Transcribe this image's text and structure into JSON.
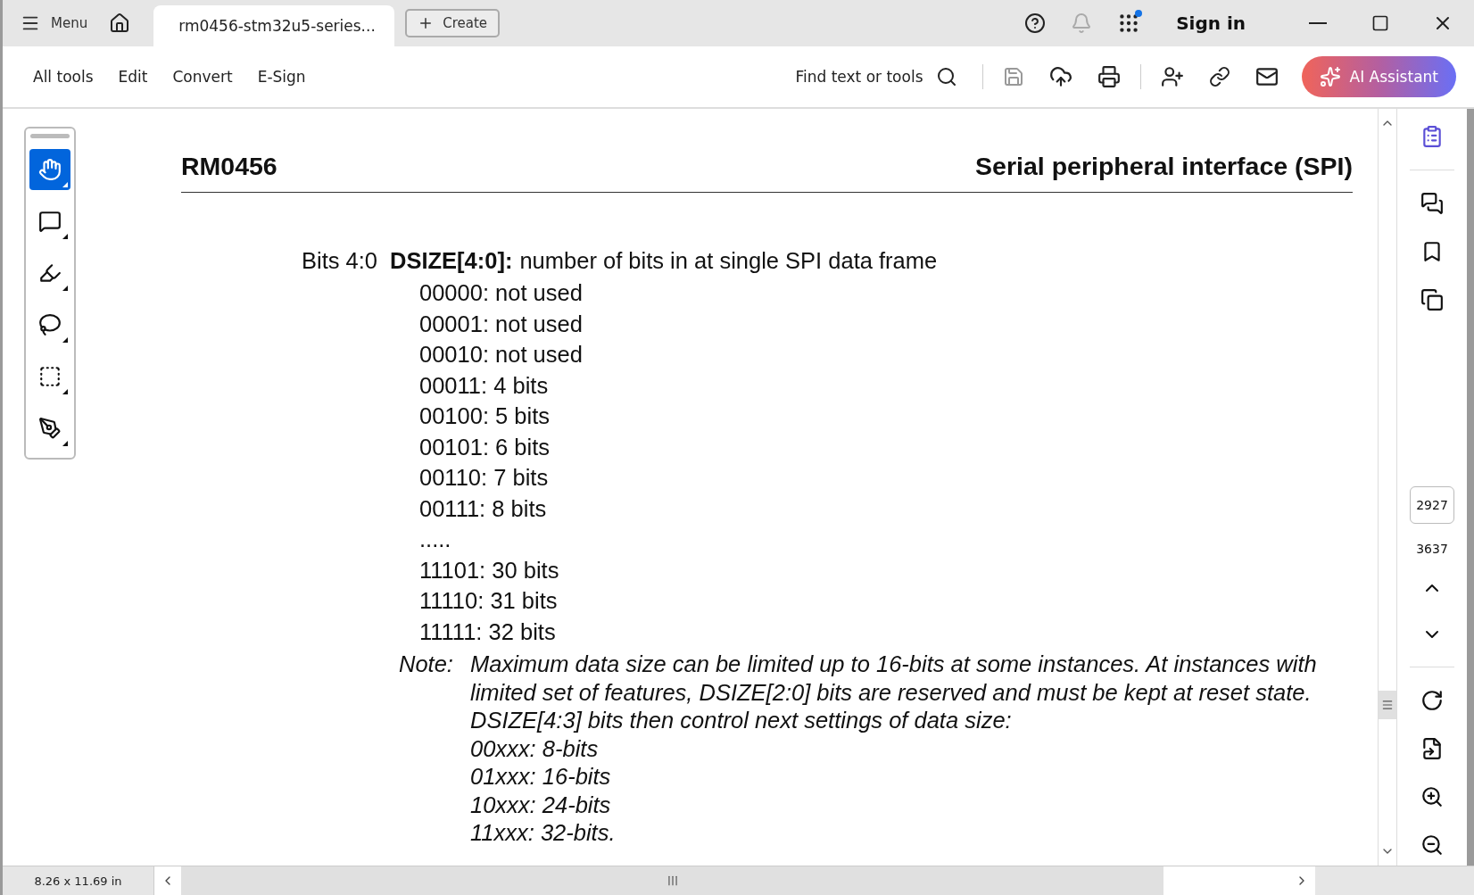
{
  "title_bar": {
    "menu_label": "Menu",
    "tab": {
      "title": "rm0456-stm32u5-series..."
    },
    "create_label": "Create",
    "notification_dot": true,
    "sign_in": "Sign in"
  },
  "toolbar": {
    "menus": [
      "All tools",
      "Edit",
      "Convert",
      "E-Sign"
    ],
    "search_label": "Find text or tools",
    "ai_button": "AI Assistant"
  },
  "tool_panel": {
    "tools": [
      {
        "kind": "hand",
        "selected": true
      },
      {
        "kind": "comment",
        "selected": false
      },
      {
        "kind": "highlighter",
        "selected": false
      },
      {
        "kind": "lasso",
        "selected": false
      },
      {
        "kind": "text-select",
        "selected": false
      },
      {
        "kind": "sign",
        "selected": false
      }
    ]
  },
  "document": {
    "header_left": "RM0456",
    "header_right": "Serial peripheral interface (SPI)",
    "field": {
      "bits": "Bits 4:0",
      "name": "DSIZE[4:0]:",
      "description": "number of bits in at single SPI data frame",
      "values": [
        "00000: not used",
        "00001: not used",
        "00010: not used",
        "00011: 4 bits",
        "00100: 5 bits",
        "00101: 6 bits",
        "00110: 7 bits",
        "00111: 8 bits",
        ".....",
        "11101: 30 bits",
        "11110: 31 bits",
        "11111: 32 bits"
      ]
    },
    "note": {
      "label": "Note:",
      "lines": [
        "Maximum data size can be limited up to 16-bits at some instances. At instances with",
        "limited set of features, DSIZE[2:0] bits are reserved and must be kept at reset state.",
        "DSIZE[4:3] bits then control next settings of data size:",
        "00xxx: 8-bits",
        "01xxx: 16-bits",
        "10xxx: 24-bits",
        "11xxx: 32-bits."
      ]
    }
  },
  "page_nav": {
    "current_page": "2927",
    "total_pages": "3637"
  },
  "status_bar": {
    "page_size": "8.26 x 11.69 in"
  }
}
